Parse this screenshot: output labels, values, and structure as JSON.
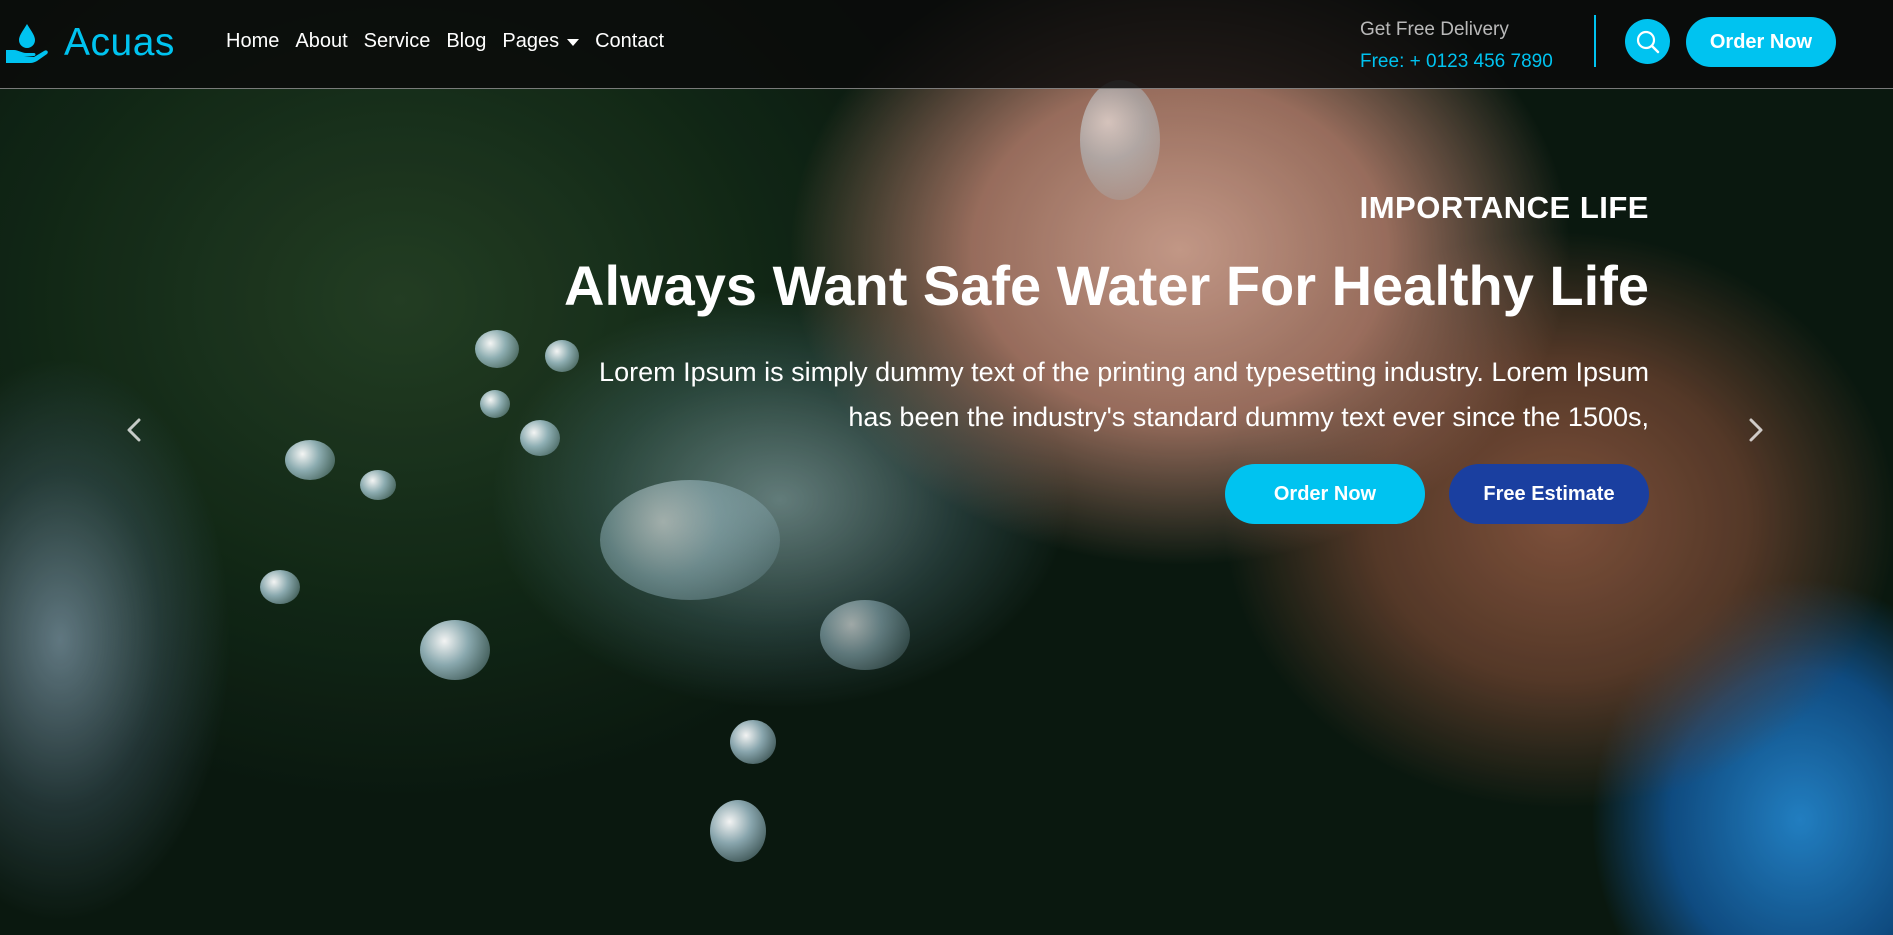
{
  "brand": {
    "name": "Acuas",
    "icon": "water-hand-icon",
    "accent_color": "#00c3f0"
  },
  "nav": {
    "items": [
      {
        "label": "Home"
      },
      {
        "label": "About"
      },
      {
        "label": "Service"
      },
      {
        "label": "Blog"
      },
      {
        "label": "Pages",
        "dropdown": true
      },
      {
        "label": "Contact"
      }
    ]
  },
  "header": {
    "delivery_label": "Get Free Delivery",
    "delivery_phone": "Free: + 0123 456 7890",
    "search_icon": "search-icon",
    "order_label": "Order Now"
  },
  "hero": {
    "eyebrow": "IMPORTANCE LIFE",
    "title": "Always Want Safe Water For Healthy Life",
    "description": "Lorem Ipsum is simply dummy text of the printing and typesetting industry. Lorem Ipsum has been the industry's standard dummy text ever since the 1500s,",
    "primary_button": "Order Now",
    "secondary_button": "Free Estimate",
    "primary_color": "#00c3f0",
    "secondary_color": "#1a3fa0",
    "prev_icon": "chevron-left-icon",
    "next_icon": "chevron-right-icon"
  }
}
